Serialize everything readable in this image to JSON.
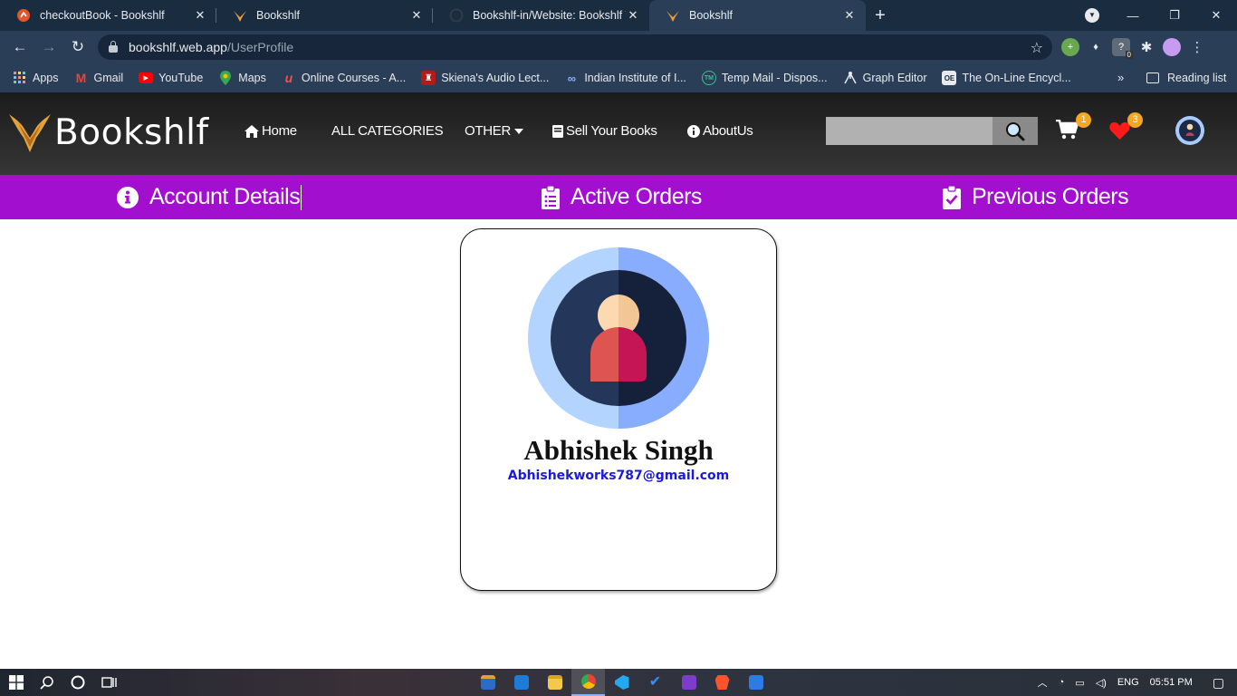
{
  "browser": {
    "tabs": [
      {
        "title": "checkoutBook - Bookshlf",
        "icon": "bookshlf-orange-icon"
      },
      {
        "title": "Bookshlf",
        "icon": "bookshlf-logo-icon"
      },
      {
        "title": "Bookshlf-in/Website: Bookshlf W",
        "icon": "github-icon"
      },
      {
        "title": "Bookshlf",
        "icon": "bookshlf-logo-icon",
        "active": true
      }
    ],
    "close_glyph": "✕",
    "new_tab_glyph": "+",
    "url_host": "bookshlf.web.app",
    "url_path": "/UserProfile",
    "ext_badge": "0",
    "bookmarks": [
      {
        "label": "Apps",
        "icon": "apps-grid-icon"
      },
      {
        "label": "Gmail",
        "icon": "gmail-icon"
      },
      {
        "label": "YouTube",
        "icon": "youtube-icon"
      },
      {
        "label": "Maps",
        "icon": "maps-icon"
      },
      {
        "label": "Online Courses - A...",
        "icon": "udemy-icon"
      },
      {
        "label": "Skiena's Audio Lect...",
        "icon": "shield-crest-icon"
      },
      {
        "label": "Indian Institute of I...",
        "icon": "link-icon"
      },
      {
        "label": "Temp Mail - Dispos...",
        "icon": "tempmail-icon"
      },
      {
        "label": "Graph Editor",
        "icon": "graph-icon"
      },
      {
        "label": "The On-Line Encycl...",
        "icon": "oeis-icon"
      }
    ],
    "bookmarks_more": "»",
    "reading_list": "Reading list"
  },
  "site": {
    "brand": "Bookshlf",
    "nav": {
      "home": "Home",
      "categories": "ALL CATEGORIES",
      "other": "OTHER",
      "sell": "Sell Your Books",
      "about": "AboutUs"
    },
    "search_placeholder": "",
    "cart_count": "1",
    "wishlist_count": "3"
  },
  "profile_tabs": {
    "account": "Account Details",
    "active": "Active Orders",
    "previous": "Previous Orders"
  },
  "user": {
    "name": "Abhishek Singh",
    "email": "Abhishekworks787@gmail.com"
  },
  "taskbar": {
    "lang": "ENG",
    "time": "05:51 PM"
  },
  "colors": {
    "purple_bar": "#a20fcf",
    "badge": "#f5a623",
    "email_link": "#1a1adb"
  }
}
